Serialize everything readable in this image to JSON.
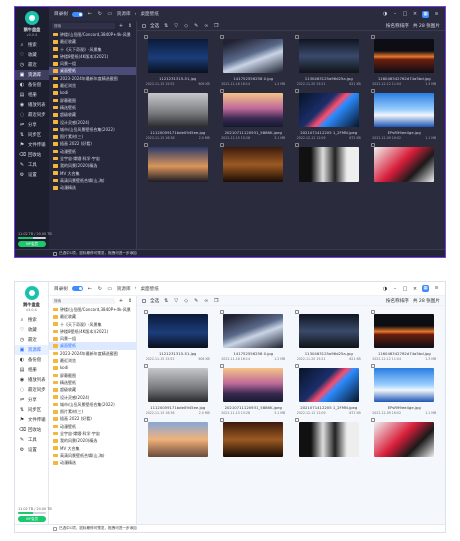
{
  "app": {
    "name": "鹅牛盘盘",
    "version": "v3.0.4"
  },
  "sidebar": [
    {
      "icon": "⌕",
      "label": "搜索"
    },
    {
      "icon": "♡",
      "label": "收藏"
    },
    {
      "icon": "◷",
      "label": "最近"
    },
    {
      "icon": "▣",
      "label": "资源库"
    },
    {
      "icon": "◐",
      "label": "备份盘"
    },
    {
      "icon": "▤",
      "label": "相册"
    },
    {
      "icon": "◉",
      "label": "播放列表"
    },
    {
      "icon": "◌",
      "label": "最近同步"
    },
    {
      "icon": "⇌",
      "label": "分享"
    },
    {
      "icon": "⇅",
      "label": "同步区"
    },
    {
      "icon": "⚑",
      "label": "文件传输"
    },
    {
      "icon": "⌫",
      "label": "回收站"
    },
    {
      "icon": "✎",
      "label": "工具"
    },
    {
      "icon": "⚙",
      "label": "设置"
    }
  ],
  "storage": {
    "text": "11.02 TB / 20.00 TB",
    "fraction": 0.55,
    "vip_label": "VIP会员"
  },
  "toolbar": {
    "toggle_label": "目录树",
    "breadcrumb_root": "资源库",
    "breadcrumb_current": "桌面壁纸"
  },
  "tree": {
    "search_placeholder": "搜索",
    "items": [
      "钟楼/山岳图/Concord,3840P+4k-风景",
      "最近收藏",
      "十《天下奇观》-风景集",
      "钟楼8壁纸(4K版本)(2021)",
      "风景一组",
      "桌面壁纸",
      "2023-2024年最新年度精选截图",
      "最近浏览",
      "kodi",
      "屏幕截图",
      "精选壁纸",
      "超级收藏",
      "设计灵感(2024)",
      "城市/山岳风景壁纸合集(2022)",
      "照片素材(三)",
      "插画 2022 (好看)",
      "动漫壁纸",
      "全宇宙·嫦娥·科学·宇宙",
      "我的风景(2020)精选",
      "MV 大合集",
      "高清风景壁纸合辑(山,海)",
      "动漫精选"
    ]
  },
  "grid": {
    "select_all": "全选",
    "sort_label": "按名称排序",
    "count_label": "共 28 张图片",
    "files": [
      {
        "name": "1121231315-51.jpg",
        "date": "2022-11-15 15:52",
        "size": "906 KB"
      },
      {
        "name": "141752556258 0.jpg",
        "date": "2022-11-16 16:14",
        "size": "1.2 MB"
      },
      {
        "name": "1130463125a96d25a.jpg",
        "date": "2022-11-20 15:21",
        "size": "821 KB"
      },
      {
        "name": "116046342762d74a5bd.jpg",
        "date": "2022-12-12 11:04",
        "size": "1.3 MB"
      },
      {
        "name": "11120059171bde0945ee.jpg",
        "date": "2022-11-15 16:38",
        "size": "2.0 MB"
      },
      {
        "name": "20210711120931_5886K.jpeg",
        "date": "2022-11-15 15:28",
        "size": "3.1 MB"
      },
      {
        "name": "2021071412205 1_2FMN.jpeg",
        "date": "2022-12-12 12:09",
        "size": "872 KB"
      },
      {
        "name": "EPsR99ee4ge.jpg",
        "date": "2022-12-09 16:02",
        "size": "1.1 MB"
      },
      {
        "name": "",
        "date": "",
        "size": ""
      },
      {
        "name": "",
        "date": "",
        "size": ""
      },
      {
        "name": "",
        "date": "",
        "size": ""
      },
      {
        "name": "",
        "date": "",
        "size": ""
      }
    ]
  },
  "statusbar": {
    "text": "已选中1项，鼠标悬停可预览，拖拽可进一步添加"
  },
  "colors": {
    "accent": "#3d8bff",
    "dark_bg": "#2a2b3d",
    "dark_border": "#7a3df0",
    "light_bg": "#f4f7fb",
    "folder": "#f3b73d",
    "brand": "#18c2b0"
  }
}
